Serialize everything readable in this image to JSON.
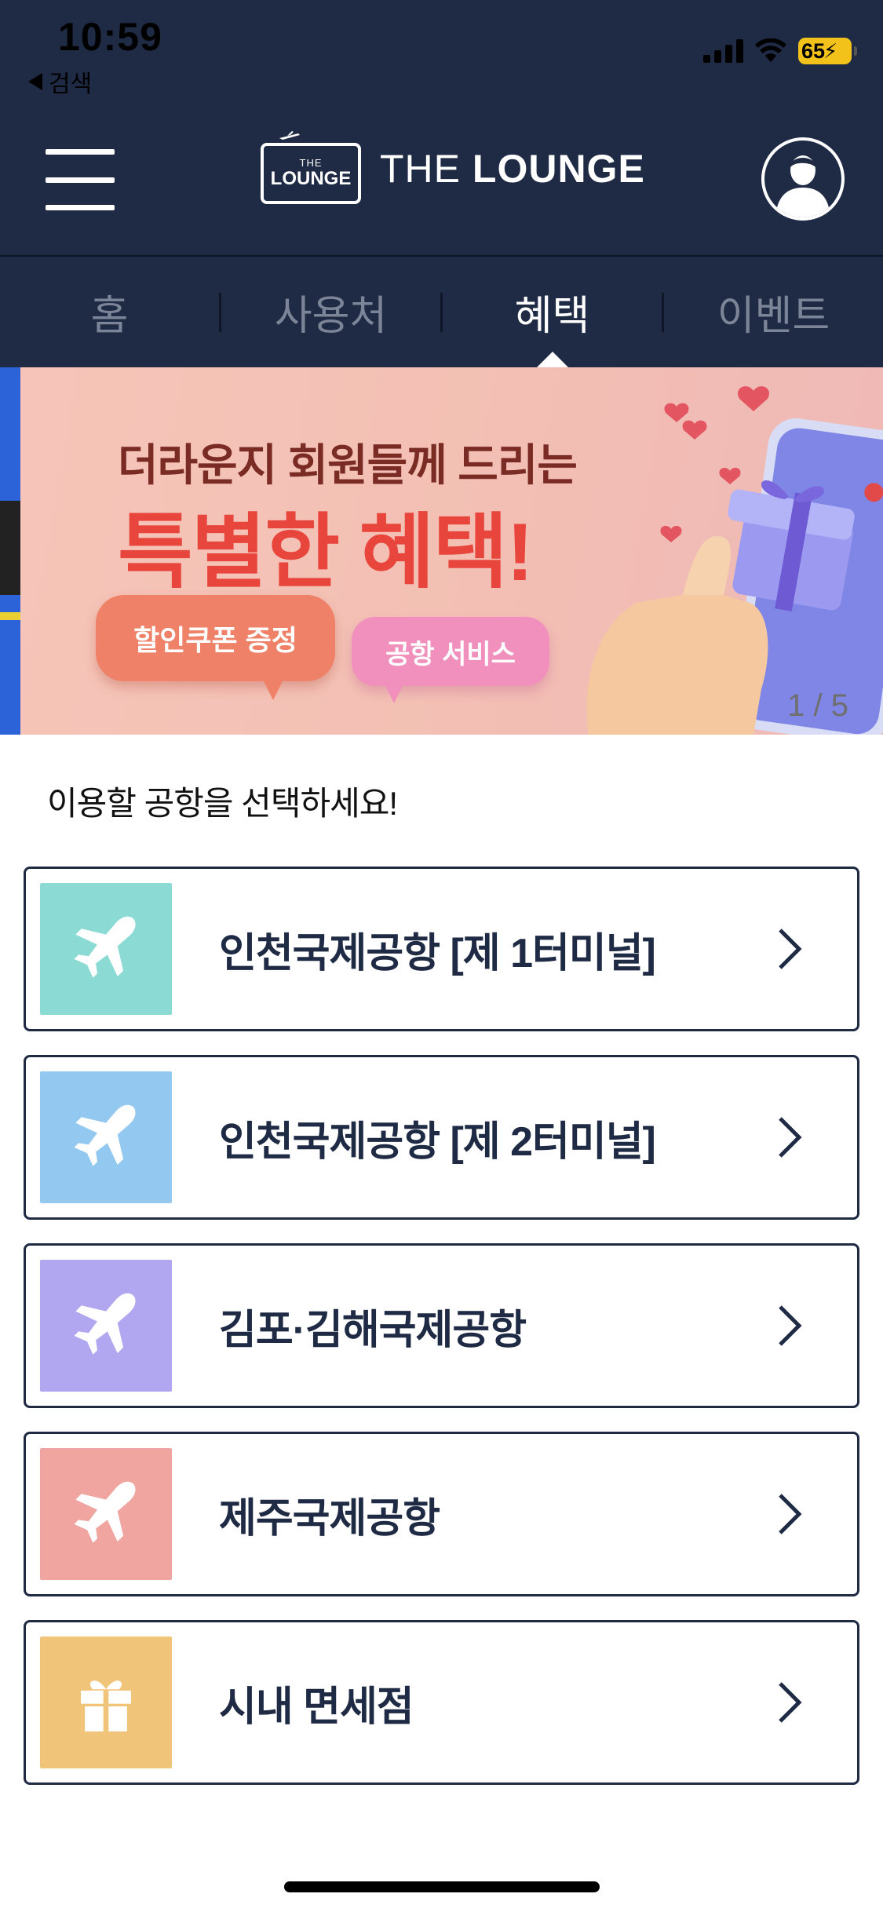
{
  "status_bar": {
    "time": "10:59",
    "back_label": "검색",
    "battery_level": "65"
  },
  "header": {
    "logo_badge_small": "THE",
    "logo_badge_big": "LOUNGE",
    "logo_text_light": "THE ",
    "logo_text_bold": "LOUNGE",
    "menu_icon": "hamburger-menu-icon",
    "profile_icon": "user-profile-icon"
  },
  "tabs": [
    {
      "label": "홈"
    },
    {
      "label": "사용처"
    },
    {
      "label": "혜택"
    },
    {
      "label": "이벤트"
    }
  ],
  "active_tab": "혜택",
  "banner": {
    "line1": "더라운지 회원들께 드리는",
    "line2": "특별한 혜택!",
    "bubble1": "할인쿠폰 증정",
    "bubble2": "공항 서비스",
    "counter": "1 / 5"
  },
  "section_title": "이용할 공항을 선택하세요!",
  "airports": [
    {
      "label": "인천국제공항 [제 1터미널]",
      "icon": "airplane-icon",
      "color": "#8bdbd4"
    },
    {
      "label": "인천국제공항 [제 2터미널]",
      "icon": "airplane-icon",
      "color": "#93c9f0"
    },
    {
      "label": "김포·김해국제공항",
      "icon": "airplane-icon",
      "color": "#b0a7f0"
    },
    {
      "label": "제주국제공항",
      "icon": "airplane-icon",
      "color": "#f0a5a1"
    },
    {
      "label": "시내 면세점",
      "icon": "gift-icon",
      "color": "#f0c57a"
    }
  ],
  "colors": {
    "navy": "#1f2a44",
    "tab_inactive": "#7c8598",
    "banner_red": "#e8453c"
  }
}
